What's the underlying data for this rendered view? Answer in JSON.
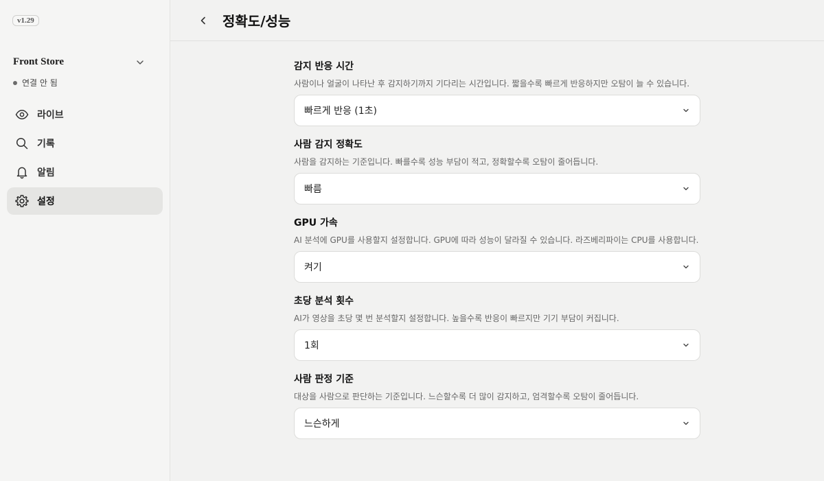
{
  "sidebar": {
    "version": "v1.29",
    "store_name": "Front Store",
    "connection_status": "연결 안 됨",
    "items": [
      {
        "label": "라이브",
        "icon": "eye-icon"
      },
      {
        "label": "기록",
        "icon": "search-icon"
      },
      {
        "label": "알림",
        "icon": "bell-icon"
      },
      {
        "label": "설정",
        "icon": "gear-icon",
        "active": true
      }
    ]
  },
  "header": {
    "title": "정확도/성능"
  },
  "settings": [
    {
      "title": "감지 반응 시간",
      "desc": "사람이나 얼굴이 나타난 후 감지하기까지 기다리는 시간입니다. 짧을수록 빠르게 반응하지만 오탐이 늘 수 있습니다.",
      "value": "빠르게 반응 (1초)"
    },
    {
      "title": "사람 감지 정확도",
      "desc": "사람을 감지하는 기준입니다. 빠를수록 성능 부담이 적고, 정확할수록 오탐이 줄어듭니다.",
      "value": "빠름"
    },
    {
      "title": "GPU 가속",
      "desc": "AI 분석에 GPU를 사용할지 설정합니다. GPU에 따라 성능이 달라질 수 있습니다. 라즈베리파이는 CPU를 사용합니다.",
      "value": "켜기"
    },
    {
      "title": "초당 분석 횟수",
      "desc": "AI가 영상을 초당 몇 번 분석할지 설정합니다. 높을수록 반응이 빠르지만 기기 부담이 커집니다.",
      "value": "1회"
    },
    {
      "title": "사람 판정 기준",
      "desc": "대상을 사람으로 판단하는 기준입니다. 느슨할수록 더 많이 감지하고, 엄격할수록 오탐이 줄어듭니다.",
      "value": "느슨하게"
    }
  ]
}
